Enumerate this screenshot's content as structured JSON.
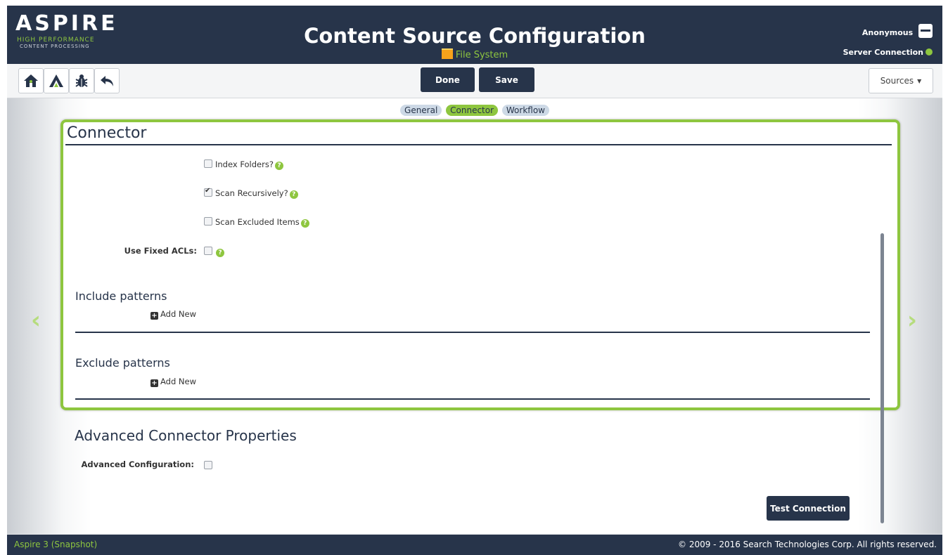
{
  "header": {
    "logo": {
      "name": "ASPIRE",
      "line1": "HIGH PERFORMANCE",
      "line2": "CONTENT PROCESSING"
    },
    "title": "Content Source Configuration",
    "subtitle": "File System",
    "user": "Anonymous",
    "server_connection": "Server Connection"
  },
  "toolbar": {
    "done_label": "Done",
    "save_label": "Save",
    "sources_label": "Sources"
  },
  "tabs": [
    {
      "label": "General",
      "active": false
    },
    {
      "label": "Connector",
      "active": true
    },
    {
      "label": "Workflow",
      "active": false
    }
  ],
  "connector": {
    "title": "Connector",
    "options": [
      {
        "label": "Index Folders?",
        "checked": false
      },
      {
        "label": "Scan Recursively?",
        "checked": true
      },
      {
        "label": "Scan Excluded Items",
        "checked": false
      }
    ],
    "use_fixed_acls_label": "Use Fixed ACLs:",
    "include_patterns": {
      "title": "Include patterns",
      "add_label": "Add New"
    },
    "exclude_patterns": {
      "title": "Exclude patterns",
      "add_label": "Add New"
    }
  },
  "advanced": {
    "title": "Advanced Connector Properties",
    "config_label": "Advanced Configuration:"
  },
  "test_connection_label": "Test Connection",
  "footer": {
    "left": "Aspire 3 (Snapshot)",
    "right": "© 2009 - 2016 Search Technologies Corp. All rights reserved."
  },
  "colors": {
    "navy": "#27344a",
    "accent_green": "#8ec63f"
  }
}
